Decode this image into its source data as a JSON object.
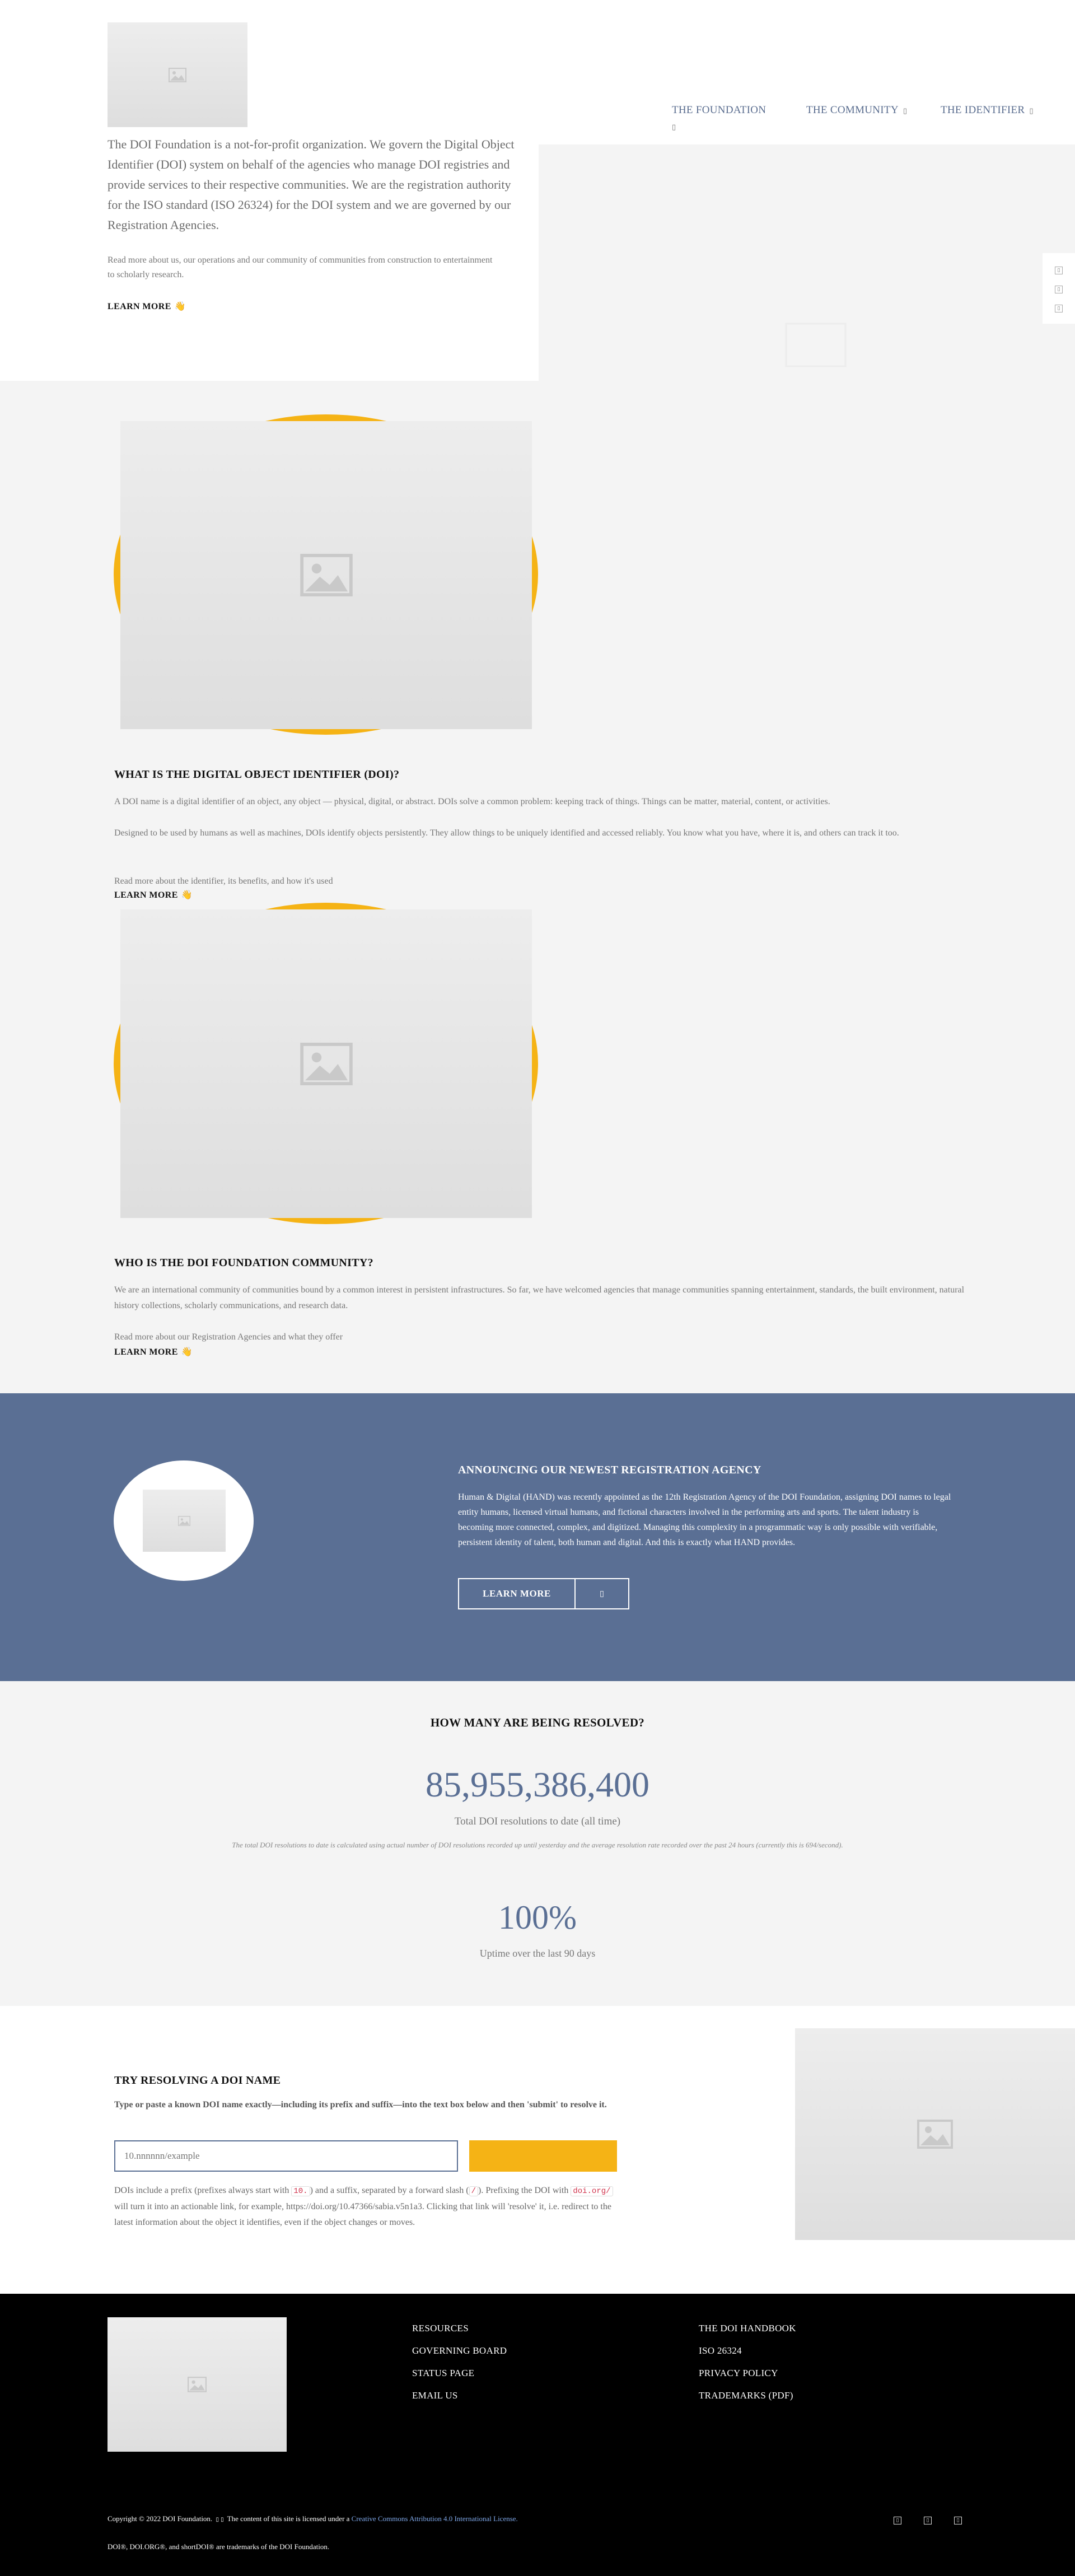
{
  "nav": {
    "items": [
      {
        "label": "THE FOUNDATION"
      },
      {
        "label": "THE COMMUNITY"
      },
      {
        "label": "THE IDENTIFIER"
      }
    ]
  },
  "hero": {
    "lead": "The DOI Foundation is a not-for-profit organization. We govern the Digital Object Identifier (DOI) system on behalf of the agencies who manage DOI registries and provide services to their respective communities. We are the registration authority for the ISO standard (ISO 26324) for the DOI system and we are governed by our Registration Agencies.",
    "sub": "Read more about us, our operations and our community of communities from construction to entertainment to scholarly research.",
    "learn_more": "LEARN MORE"
  },
  "identifier_section": {
    "title": "WHAT IS THE DIGITAL OBJECT IDENTIFIER (DOI)?",
    "p1": "A DOI name is a digital identifier of an object, any object — physical, digital, or abstract. DOIs solve a common problem: keeping track of things. Things can be matter, material, content, or activities.",
    "p2": "Designed to be used by humans as well as machines, DOIs identify objects persistently. They allow things to be uniquely identified and accessed reliably. You know what you have, where it is, and others can track it too.",
    "p3": "Read more about the identifier, its benefits, and how it's used",
    "learn_more": "LEARN MORE"
  },
  "community_section": {
    "title": "WHO IS THE DOI FOUNDATION COMMUNITY?",
    "p1": "We are an international community of communities bound by a common interest in persistent infrastructures. So far, we have welcomed agencies that manage communities spanning entertainment, standards, the built environment, natural history collections, scholarly communications, and research data.",
    "p2": "Read more about our Registration Agencies and what they offer",
    "learn_more": "LEARN MORE"
  },
  "announcement": {
    "title": "ANNOUNCING OUR NEWEST REGISTRATION AGENCY",
    "body": "Human & Digital (HAND) was recently appointed as the 12th Registration Agency of the DOI Foundation, assigning DOI names to legal entity humans, licensed virtual humans, and fictional characters involved in the performing arts and sports. The talent industry is becoming more connected, complex, and digitized. Managing this complexity in a programmatic way is only possible with verifiable, persistent identity of talent, both human and digital. And this is exactly what HAND provides.",
    "button_label": "LEARN MORE"
  },
  "stats": {
    "title": "HOW MANY ARE BEING RESOLVED?",
    "total_value": "85,955,386,400",
    "total_label": "Total DOI resolutions to date (all time)",
    "note": "The total DOI resolutions to date is calculated using actual number of DOI resolutions recorded up until yesterday and the average resolution rate recorded over the past 24 hours (currently this is 694/second).",
    "uptime_value": "100%",
    "uptime_label": "Uptime over the last 90 days"
  },
  "resolver": {
    "title": "TRY RESOLVING A DOI NAME",
    "instructions": "Type or paste a known DOI name exactly—including its prefix and suffix—into the text box below and then 'submit' to resolve it.",
    "input_placeholder": "10.nnnnnn/example",
    "submit_label": "",
    "explain_1": "DOIs include a prefix (prefixes always start with ",
    "code_prefix": "10.",
    "explain_2": ") and a suffix, separated by a forward slash (",
    "code_slash": "/",
    "explain_3": "). Prefixing the DOI with ",
    "code_doiorg": "doi.org/",
    "explain_4": " will turn it into an actionable link, for example, https://doi.org/10.47366/sabia.v5n1a3. Clicking that link will 'resolve' it, i.e. redirect to the latest information about the object it identifies, even if the object changes or moves."
  },
  "footer": {
    "col1": [
      "RESOURCES",
      "GOVERNING BOARD",
      "STATUS PAGE",
      "EMAIL US"
    ],
    "col2": [
      "THE DOI HANDBOOK",
      "ISO 26324",
      "PRIVACY POLICY",
      "TRADEMARKS (PDF)"
    ],
    "copyright_pre": "Copyright © 2022 DOI Foundation.",
    "copyright_mid": "The content of this site is licensed under a",
    "license_link": "Creative Commons Attribution 4.0 International License.",
    "trademark": "DOI®, DOI.ORG®, and shortDOI® are trademarks of the DOI Foundation."
  },
  "colors": {
    "accent_yellow": "#f5b315",
    "brand_blue": "#5a6f94",
    "footer_bg": "#000000"
  },
  "icons": [
    "image-placeholder-icon",
    "chevron-down-icon",
    "hand-wave-icon",
    "external-link-icon",
    "social-icon"
  ]
}
